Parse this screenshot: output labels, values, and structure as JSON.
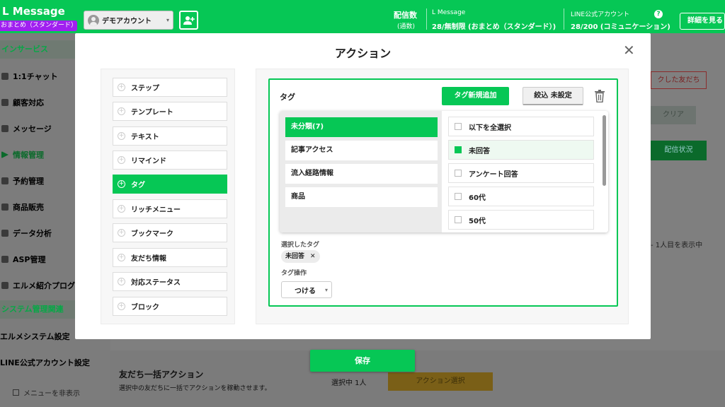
{
  "header": {
    "brand": "L Message",
    "plan_badge": "おまとめ（スタンダード）",
    "account_name": "デモアカウント",
    "send_count_label": "配信数",
    "send_count_sub": "(通数)",
    "lmessage_label": "L Message",
    "lmessage_value": "28/無制限 (おまとめ（スタンダード）)",
    "line_official_label": "LINE公式アカウント",
    "line_official_value": "28/200 (コミュニケーション)",
    "details_button": "詳細を見る",
    "help": "?"
  },
  "sidebar": {
    "section_main": "インサービス",
    "items": [
      {
        "label": "1:1チャット"
      },
      {
        "label": "顧客対応"
      },
      {
        "label": "メッセージ"
      },
      {
        "label": "情報管理"
      },
      {
        "label": "予約管理"
      },
      {
        "label": "商品販売"
      },
      {
        "label": "データ分析"
      },
      {
        "label": "ASP管理"
      },
      {
        "label": "エルメ紹介プログラム"
      }
    ],
    "section_system": "システム管理関連",
    "system_items": [
      {
        "label": "エルメシステム設定"
      },
      {
        "label": "LINE公式アカウント設定"
      }
    ],
    "hide_menu": "メニューを非表示"
  },
  "background": {
    "friends_button": "クした友だち",
    "clear_button": "クリア",
    "delivery_button": "配信状況",
    "count_text": "- 1人目を表示中",
    "bulk_title": "友だち一括アクション",
    "bulk_desc": "選択中の友だちに一括でアクションを稼動させます。",
    "selected_text": "選択中 1人",
    "action_select_button": "アクション選択"
  },
  "modal": {
    "title": "アクション",
    "close": "✕",
    "actions": [
      {
        "label": "ステップ",
        "active": false
      },
      {
        "label": "テンプレート",
        "active": false
      },
      {
        "label": "テキスト",
        "active": false
      },
      {
        "label": "リマインド",
        "active": false
      },
      {
        "label": "タグ",
        "active": true
      },
      {
        "label": "リッチメニュー",
        "active": false
      },
      {
        "label": "ブックマーク",
        "active": false
      },
      {
        "label": "友だち情報",
        "active": false
      },
      {
        "label": "対応ステータス",
        "active": false
      },
      {
        "label": "ブロック",
        "active": false
      }
    ],
    "tag_panel": {
      "label": "タグ",
      "new_tag_button": "タグ新規追加",
      "filter_button": "絞込 未設定",
      "categories": [
        {
          "label": "未分類(7)",
          "selected": true
        },
        {
          "label": "記事アクセス",
          "selected": false
        },
        {
          "label": "流入経路情報",
          "selected": false
        },
        {
          "label": "商品",
          "selected": false
        }
      ],
      "tags": [
        {
          "label": "以下を全選択",
          "checked": false
        },
        {
          "label": "未回答",
          "checked": true
        },
        {
          "label": "アンケート回答",
          "checked": false
        },
        {
          "label": "60代",
          "checked": false
        },
        {
          "label": "50代",
          "checked": false
        }
      ],
      "selected_tags_label": "選択したタグ",
      "selected_tags": [
        "未回答"
      ],
      "chip_remove": "✕",
      "operation_label": "タグ操作",
      "operation_value": "つける"
    },
    "save_button": "保存"
  },
  "colors": {
    "brand_green": "#06c755",
    "badge_purple": "#a020f0",
    "action_yellow": "#e8b422"
  }
}
